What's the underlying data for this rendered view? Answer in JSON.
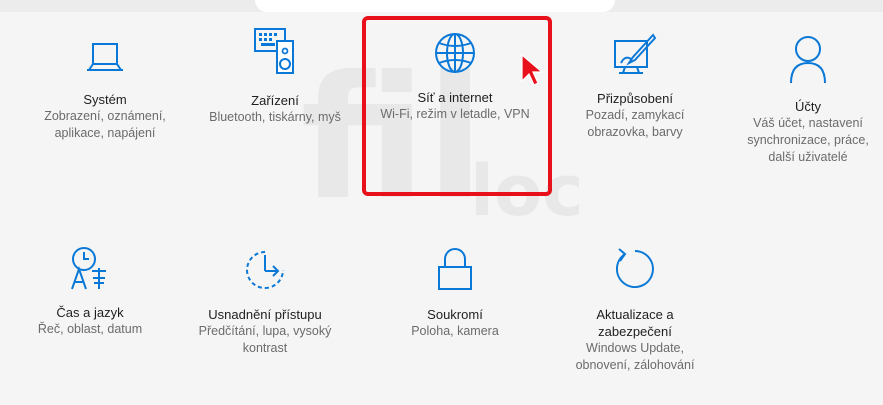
{
  "accent_color": "#0a78d7",
  "highlight_color": "#e8101a",
  "tiles": [
    {
      "icon": "laptop-icon",
      "title": "Systém",
      "desc": "Zobrazení, oznámení, aplikace, napájení"
    },
    {
      "icon": "devices-icon",
      "title": "Zařízení",
      "desc": "Bluetooth, tiskárny, myš"
    },
    {
      "icon": "globe-icon",
      "title": "Síť a internet",
      "desc": "Wi-Fi, režim v letadle, VPN"
    },
    {
      "icon": "personalization-icon",
      "title": "Přizpůsobení",
      "desc": "Pozadí, zamykací obrazovka, barvy"
    },
    {
      "icon": "person-icon",
      "title": "Účty",
      "desc": "Váš účet, nastavení synchronizace, práce, další uživatelé"
    },
    {
      "icon": "time-language-icon",
      "title": "Čas a jazyk",
      "desc": "Řeč, oblast, datum"
    },
    {
      "icon": "ease-of-access-icon",
      "title": "Usnadnění přístupu",
      "desc": "Předčítání, lupa, vysoký kontrast"
    },
    {
      "icon": "lock-icon",
      "title": "Soukromí",
      "desc": "Poloha, kamera"
    },
    {
      "icon": "update-icon",
      "title": "Aktualizace a zabezpečení",
      "desc": "Windows Update, obnovení, zálohování"
    }
  ]
}
